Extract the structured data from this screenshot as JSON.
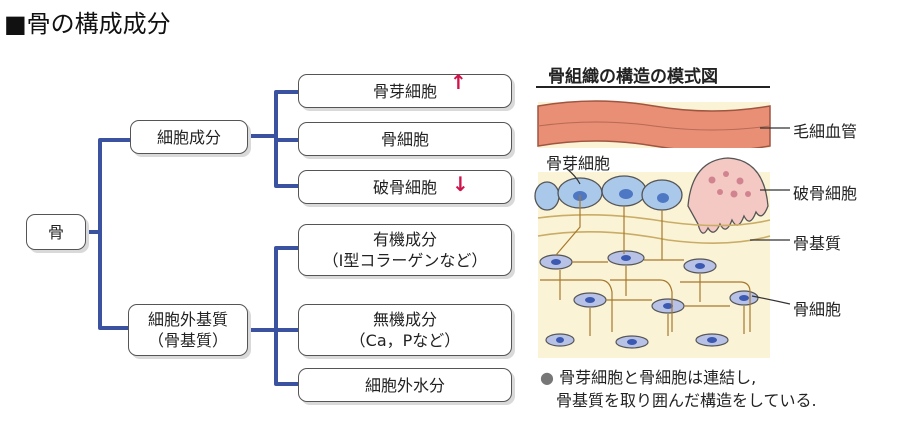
{
  "title": "■骨の構成成分",
  "tree": {
    "root": "骨",
    "branches": [
      {
        "label": "細胞成分",
        "children": [
          "骨芽細胞",
          "骨細胞",
          "破骨細胞"
        ]
      },
      {
        "label_line1": "細胞外基質",
        "label_line2": "（骨基質）",
        "children": [
          {
            "line1": "有機成分",
            "line2": "（Ⅰ型コラーゲンなど）"
          },
          {
            "line1": "無機成分",
            "line2": "（Ca，Pなど）"
          },
          {
            "line1": "細胞外水分"
          }
        ]
      }
    ],
    "annotations": {
      "up": "↑",
      "down": "↓"
    }
  },
  "panel": {
    "title": "骨組織の構造の模式図",
    "labels": {
      "capillary": "毛細血管",
      "osteoblast": "骨芽細胞",
      "osteoclast": "破骨細胞",
      "matrix": "骨基質",
      "osteocyte": "骨細胞"
    },
    "note_line1": "骨芽細胞と骨細胞は連結し,",
    "note_line2": "骨基質を取り囲んだ構造をしている.",
    "bullet": "●"
  },
  "colors": {
    "tree_line": "#3b52a0",
    "annotation": "#d0144b",
    "vessel": "#e88f75",
    "osteoblast": "#a9c8ea",
    "osteoclast": "#f4c9c4",
    "matrix": "#fbf3d6",
    "osteocyte": "#b7c2e6"
  }
}
